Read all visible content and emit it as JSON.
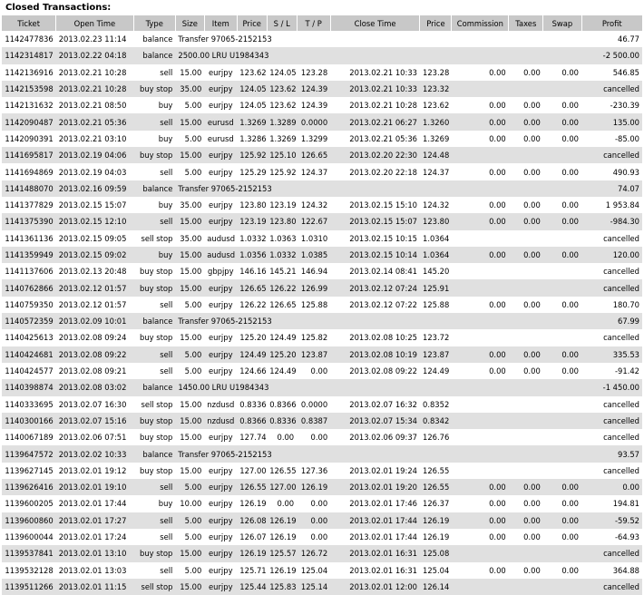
{
  "title": "Closed Transactions:",
  "columns": [
    "Ticket",
    "Open Time",
    "Type",
    "Size",
    "Item",
    "Price",
    "S / L",
    "T / P",
    "Close Time",
    "Price",
    "Commission",
    "Taxes",
    "Swap",
    "Profit"
  ],
  "rows": [
    {
      "kind": "bal",
      "ticket": "1142477836",
      "open_time": "2013.02.23 11:14",
      "type": "balance",
      "desc": "Transfer 97065-2152153",
      "profit": "46.77"
    },
    {
      "kind": "bal",
      "ticket": "1142314817",
      "open_time": "2013.02.22 04:18",
      "type": "balance",
      "desc": "2500.00 LRU U1984343",
      "profit": "-2 500.00"
    },
    {
      "kind": "trade",
      "ticket": "1142136916",
      "open_time": "2013.02.21 10:28",
      "type": "sell",
      "size": "15.00",
      "item": "eurjpy",
      "price": "123.62",
      "sl": "124.05",
      "tp": "123.28",
      "close_time": "2013.02.21 10:33",
      "close_price": "123.28",
      "commission": "0.00",
      "taxes": "0.00",
      "swap": "0.00",
      "profit": "546.85"
    },
    {
      "kind": "cancel",
      "ticket": "1142153598",
      "open_time": "2013.02.21 10:28",
      "type": "buy stop",
      "size": "35.00",
      "item": "eurjpy",
      "price": "124.05",
      "sl": "123.62",
      "tp": "124.39",
      "close_time": "2013.02.21 10:33",
      "close_price": "123.32",
      "profit": "cancelled"
    },
    {
      "kind": "trade",
      "ticket": "1142131632",
      "open_time": "2013.02.21 08:50",
      "type": "buy",
      "size": "5.00",
      "item": "eurjpy",
      "price": "124.05",
      "sl": "123.62",
      "tp": "124.39",
      "close_time": "2013.02.21 10:28",
      "close_price": "123.62",
      "commission": "0.00",
      "taxes": "0.00",
      "swap": "0.00",
      "profit": "-230.39"
    },
    {
      "kind": "trade",
      "ticket": "1142090487",
      "open_time": "2013.02.21 05:36",
      "type": "sell",
      "size": "15.00",
      "item": "eurusd",
      "price": "1.3269",
      "sl": "1.3289",
      "tp": "0.0000",
      "close_time": "2013.02.21 06:27",
      "close_price": "1.3260",
      "commission": "0.00",
      "taxes": "0.00",
      "swap": "0.00",
      "profit": "135.00"
    },
    {
      "kind": "trade",
      "ticket": "1142090391",
      "open_time": "2013.02.21 03:10",
      "type": "buy",
      "size": "5.00",
      "item": "eurusd",
      "price": "1.3286",
      "sl": "1.3269",
      "tp": "1.3299",
      "close_time": "2013.02.21 05:36",
      "close_price": "1.3269",
      "commission": "0.00",
      "taxes": "0.00",
      "swap": "0.00",
      "profit": "-85.00"
    },
    {
      "kind": "cancel",
      "ticket": "1141695817",
      "open_time": "2013.02.19 04:06",
      "type": "buy stop",
      "size": "15.00",
      "item": "eurjpy",
      "price": "125.92",
      "sl": "125.10",
      "tp": "126.65",
      "close_time": "2013.02.20 22:30",
      "close_price": "124.48",
      "profit": "cancelled"
    },
    {
      "kind": "trade",
      "ticket": "1141694869",
      "open_time": "2013.02.19 04:03",
      "type": "sell",
      "size": "5.00",
      "item": "eurjpy",
      "price": "125.29",
      "sl": "125.92",
      "tp": "124.37",
      "close_time": "2013.02.20 22:18",
      "close_price": "124.37",
      "commission": "0.00",
      "taxes": "0.00",
      "swap": "0.00",
      "profit": "490.93"
    },
    {
      "kind": "bal",
      "ticket": "1141488070",
      "open_time": "2013.02.16 09:59",
      "type": "balance",
      "desc": "Transfer 97065-2152153",
      "profit": "74.07"
    },
    {
      "kind": "trade",
      "ticket": "1141377829",
      "open_time": "2013.02.15 15:07",
      "type": "buy",
      "size": "35.00",
      "item": "eurjpy",
      "price": "123.80",
      "sl": "123.19",
      "tp": "124.32",
      "close_time": "2013.02.15 15:10",
      "close_price": "124.32",
      "commission": "0.00",
      "taxes": "0.00",
      "swap": "0.00",
      "profit": "1 953.84"
    },
    {
      "kind": "trade",
      "ticket": "1141375390",
      "open_time": "2013.02.15 12:10",
      "type": "sell",
      "size": "15.00",
      "item": "eurjpy",
      "price": "123.19",
      "sl": "123.80",
      "tp": "122.67",
      "close_time": "2013.02.15 15:07",
      "close_price": "123.80",
      "commission": "0.00",
      "taxes": "0.00",
      "swap": "0.00",
      "profit": "-984.30"
    },
    {
      "kind": "cancel",
      "ticket": "1141361136",
      "open_time": "2013.02.15 09:05",
      "type": "sell stop",
      "size": "35.00",
      "item": "audusd",
      "price": "1.0332",
      "sl": "1.0363",
      "tp": "1.0310",
      "close_time": "2013.02.15 10:15",
      "close_price": "1.0364",
      "profit": "cancelled"
    },
    {
      "kind": "trade",
      "ticket": "1141359949",
      "open_time": "2013.02.15 09:02",
      "type": "buy",
      "size": "15.00",
      "item": "audusd",
      "price": "1.0356",
      "sl": "1.0332",
      "tp": "1.0385",
      "close_time": "2013.02.15 10:14",
      "close_price": "1.0364",
      "commission": "0.00",
      "taxes": "0.00",
      "swap": "0.00",
      "profit": "120.00"
    },
    {
      "kind": "cancel",
      "ticket": "1141137606",
      "open_time": "2013.02.13 20:48",
      "type": "buy stop",
      "size": "15.00",
      "item": "gbpjpy",
      "price": "146.16",
      "sl": "145.21",
      "tp": "146.94",
      "close_time": "2013.02.14 08:41",
      "close_price": "145.20",
      "profit": "cancelled"
    },
    {
      "kind": "cancel",
      "ticket": "1140762866",
      "open_time": "2013.02.12 01:57",
      "type": "buy stop",
      "size": "15.00",
      "item": "eurjpy",
      "price": "126.65",
      "sl": "126.22",
      "tp": "126.99",
      "close_time": "2013.02.12 07:24",
      "close_price": "125.91",
      "profit": "cancelled"
    },
    {
      "kind": "trade",
      "ticket": "1140759350",
      "open_time": "2013.02.12 01:57",
      "type": "sell",
      "size": "5.00",
      "item": "eurjpy",
      "price": "126.22",
      "sl": "126.65",
      "tp": "125.88",
      "close_time": "2013.02.12 07:22",
      "close_price": "125.88",
      "commission": "0.00",
      "taxes": "0.00",
      "swap": "0.00",
      "profit": "180.70"
    },
    {
      "kind": "bal",
      "ticket": "1140572359",
      "open_time": "2013.02.09 10:01",
      "type": "balance",
      "desc": "Transfer 97065-2152153",
      "profit": "67.99"
    },
    {
      "kind": "cancel",
      "ticket": "1140425613",
      "open_time": "2013.02.08 09:24",
      "type": "buy stop",
      "size": "15.00",
      "item": "eurjpy",
      "price": "125.20",
      "sl": "124.49",
      "tp": "125.82",
      "close_time": "2013.02.08 10:25",
      "close_price": "123.72",
      "profit": "cancelled"
    },
    {
      "kind": "trade",
      "ticket": "1140424681",
      "open_time": "2013.02.08 09:22",
      "type": "sell",
      "size": "5.00",
      "item": "eurjpy",
      "price": "124.49",
      "sl": "125.20",
      "tp": "123.87",
      "close_time": "2013.02.08 10:19",
      "close_price": "123.87",
      "commission": "0.00",
      "taxes": "0.00",
      "swap": "0.00",
      "profit": "335.53"
    },
    {
      "kind": "trade",
      "ticket": "1140424577",
      "open_time": "2013.02.08 09:21",
      "type": "sell",
      "size": "5.00",
      "item": "eurjpy",
      "price": "124.66",
      "sl": "124.49",
      "tp": "0.00",
      "close_time": "2013.02.08 09:22",
      "close_price": "124.49",
      "commission": "0.00",
      "taxes": "0.00",
      "swap": "0.00",
      "profit": "-91.42"
    },
    {
      "kind": "bal",
      "ticket": "1140398874",
      "open_time": "2013.02.08 03:02",
      "type": "balance",
      "desc": "1450.00 LRU U1984343",
      "profit": "-1 450.00"
    },
    {
      "kind": "cancel",
      "ticket": "1140333695",
      "open_time": "2013.02.07 16:30",
      "type": "sell stop",
      "size": "15.00",
      "item": "nzdusd",
      "price": "0.8336",
      "sl": "0.8366",
      "tp": "0.0000",
      "close_time": "2013.02.07 16:32",
      "close_price": "0.8352",
      "profit": "cancelled"
    },
    {
      "kind": "cancel",
      "ticket": "1140300166",
      "open_time": "2013.02.07 15:16",
      "type": "buy stop",
      "size": "15.00",
      "item": "nzdusd",
      "price": "0.8366",
      "sl": "0.8336",
      "tp": "0.8387",
      "close_time": "2013.02.07 15:34",
      "close_price": "0.8342",
      "profit": "cancelled"
    },
    {
      "kind": "cancel",
      "ticket": "1140067189",
      "open_time": "2013.02.06 07:51",
      "type": "buy stop",
      "size": "15.00",
      "item": "eurjpy",
      "price": "127.74",
      "sl": "0.00",
      "tp": "0.00",
      "close_time": "2013.02.06 09:37",
      "close_price": "126.76",
      "profit": "cancelled"
    },
    {
      "kind": "bal",
      "ticket": "1139647572",
      "open_time": "2013.02.02 10:33",
      "type": "balance",
      "desc": "Transfer 97065-2152153",
      "profit": "93.57"
    },
    {
      "kind": "cancel",
      "ticket": "1139627145",
      "open_time": "2013.02.01 19:12",
      "type": "buy stop",
      "size": "15.00",
      "item": "eurjpy",
      "price": "127.00",
      "sl": "126.55",
      "tp": "127.36",
      "close_time": "2013.02.01 19:24",
      "close_price": "126.55",
      "profit": "cancelled"
    },
    {
      "kind": "trade",
      "ticket": "1139626416",
      "open_time": "2013.02.01 19:10",
      "type": "sell",
      "size": "5.00",
      "item": "eurjpy",
      "price": "126.55",
      "sl": "127.00",
      "tp": "126.19",
      "close_time": "2013.02.01 19:20",
      "close_price": "126.55",
      "commission": "0.00",
      "taxes": "0.00",
      "swap": "0.00",
      "profit": "0.00"
    },
    {
      "kind": "trade",
      "ticket": "1139600205",
      "open_time": "2013.02.01 17:44",
      "type": "buy",
      "size": "10.00",
      "item": "eurjpy",
      "price": "126.19",
      "sl": "0.00",
      "tp": "0.00",
      "close_time": "2013.02.01 17:46",
      "close_price": "126.37",
      "commission": "0.00",
      "taxes": "0.00",
      "swap": "0.00",
      "profit": "194.81"
    },
    {
      "kind": "trade",
      "ticket": "1139600860",
      "open_time": "2013.02.01 17:27",
      "type": "sell",
      "size": "5.00",
      "item": "eurjpy",
      "price": "126.08",
      "sl": "126.19",
      "tp": "0.00",
      "close_time": "2013.02.01 17:44",
      "close_price": "126.19",
      "commission": "0.00",
      "taxes": "0.00",
      "swap": "0.00",
      "profit": "-59.52"
    },
    {
      "kind": "trade",
      "ticket": "1139600044",
      "open_time": "2013.02.01 17:24",
      "type": "sell",
      "size": "5.00",
      "item": "eurjpy",
      "price": "126.07",
      "sl": "126.19",
      "tp": "0.00",
      "close_time": "2013.02.01 17:44",
      "close_price": "126.19",
      "commission": "0.00",
      "taxes": "0.00",
      "swap": "0.00",
      "profit": "-64.93"
    },
    {
      "kind": "cancel",
      "ticket": "1139537841",
      "open_time": "2013.02.01 13:10",
      "type": "buy stop",
      "size": "15.00",
      "item": "eurjpy",
      "price": "126.19",
      "sl": "125.57",
      "tp": "126.72",
      "close_time": "2013.02.01 16:31",
      "close_price": "125.08",
      "profit": "cancelled"
    },
    {
      "kind": "trade",
      "ticket": "1139532128",
      "open_time": "2013.02.01 13:03",
      "type": "sell",
      "size": "5.00",
      "item": "eurjpy",
      "price": "125.71",
      "sl": "126.19",
      "tp": "125.04",
      "close_time": "2013.02.01 16:31",
      "close_price": "125.04",
      "commission": "0.00",
      "taxes": "0.00",
      "swap": "0.00",
      "profit": "364.88"
    },
    {
      "kind": "cancel",
      "ticket": "1139511266",
      "open_time": "2013.02.01 11:15",
      "type": "sell stop",
      "size": "15.00",
      "item": "eurjpy",
      "price": "125.44",
      "sl": "125.83",
      "tp": "125.14",
      "close_time": "2013.02.01 12:00",
      "close_price": "126.14",
      "profit": "cancelled"
    }
  ]
}
